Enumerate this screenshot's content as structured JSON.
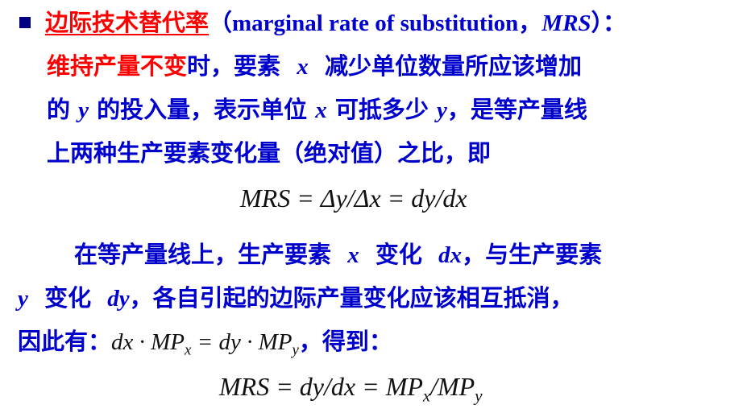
{
  "heading": {
    "term": "边际技术替代率",
    "term_english": "（marginal rate of substitution，",
    "term_abbr": "MRS",
    "term_close": "）："
  },
  "definition": {
    "line1_red": "维持产量不变",
    "line1_rest_a": "时，要素",
    "var_x": "x",
    "line1_rest_b": "减少单位数量所应该增加",
    "line2_a": "的",
    "var_y": "y",
    "line2_b": "的投入量，表示单位",
    "line2_c": "可抵多少",
    "line2_d": "，是等产量线",
    "line3": "上两种生产要素变化量（绝对值）之比，即"
  },
  "formula1": "MRS = Δy/Δx = dy/dx",
  "paragraph": {
    "line1_a": "在等产量线上，生产要素",
    "line1_b": "变化",
    "dx": "dx",
    "line1_c": "，与生产要素",
    "line2_a": "变化",
    "dy": "dy",
    "line2_b": "，各自引起的边际产量变化应该相互抵消，",
    "line3_a": "因此有：",
    "line3_formula_a": "dx · MP",
    "sub_x": "x",
    "line3_formula_b": " = dy · MP",
    "sub_y": "y",
    "line3_b": "，得到："
  },
  "formula2": {
    "left": "MRS =  dy/dx = MP",
    "sub_x": "x",
    "mid": "/MP",
    "sub_y": "y"
  },
  "colors": {
    "body_text": "#0000cc",
    "highlight": "#ff0000",
    "bullet": "#000080",
    "formula": "#111111"
  }
}
